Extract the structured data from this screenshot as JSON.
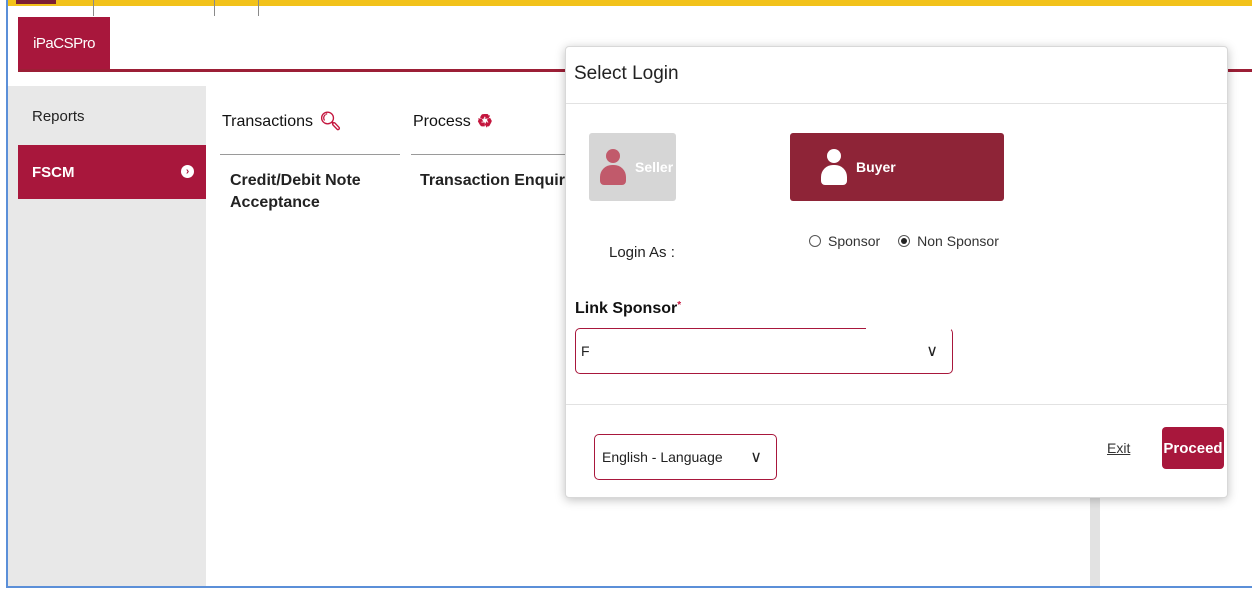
{
  "app": {
    "tab_label": "iPaCSPro"
  },
  "sidebar": {
    "items": [
      {
        "label": "Reports",
        "active": false
      },
      {
        "label": "FSCM",
        "active": true
      }
    ]
  },
  "menu": {
    "columns": [
      {
        "heading": "Transactions",
        "icon": "search-key-icon",
        "items": [
          "Credit/Debit Note",
          "Acceptance"
        ]
      },
      {
        "heading": "Process",
        "icon": "recycle-icon",
        "items": [
          "Transaction Enquiry"
        ]
      }
    ]
  },
  "modal": {
    "title": "Select Login",
    "roles": [
      {
        "label": "Seller",
        "selected": false
      },
      {
        "label": "Buyer",
        "selected": true
      }
    ],
    "login_as_label": "Login As :",
    "login_as_options": [
      {
        "label": "Sponsor",
        "checked": false
      },
      {
        "label": "Non Sponsor",
        "checked": true
      }
    ],
    "link_sponsor_label": "Link Sponsor",
    "required_marker": "*",
    "link_sponsor_value": "F",
    "language_value": "English - Language",
    "exit_label": "Exit",
    "proceed_label": "Proceed"
  },
  "colors": {
    "accent": "#a8173c",
    "buyer_selected": "#8e2437",
    "top_bar": "#f2c21a"
  }
}
